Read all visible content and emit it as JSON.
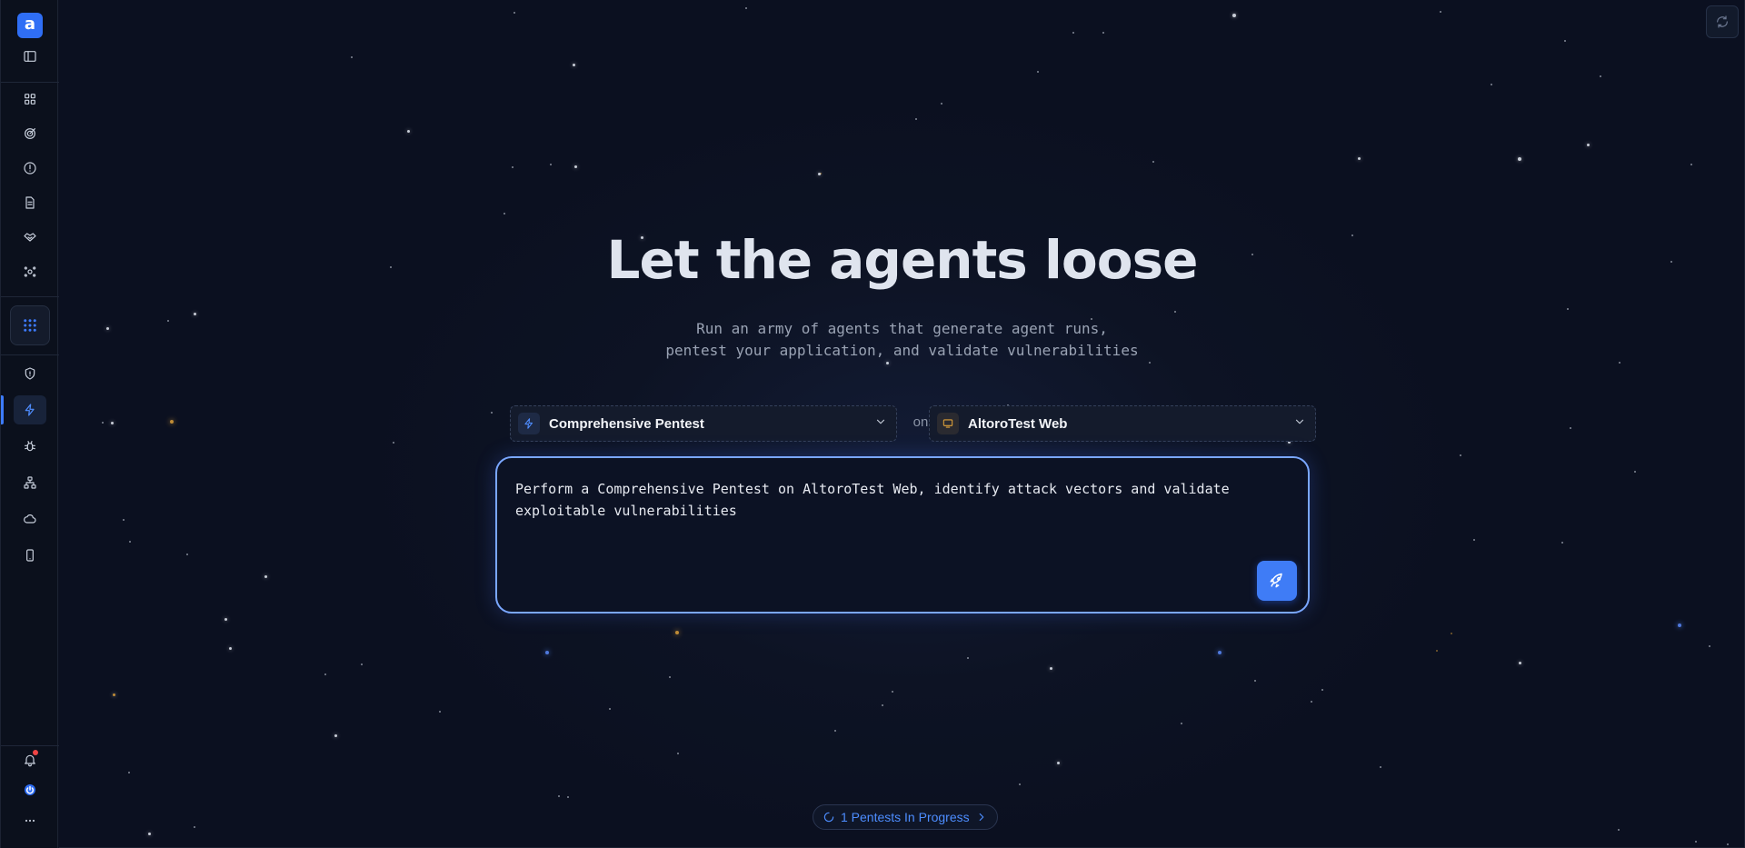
{
  "sidebar": {
    "logo_letter": "a",
    "items": [
      {
        "name": "sidebar-toggle",
        "icon": "sidebar-panel-icon"
      },
      {
        "name": "dashboard",
        "icon": "grid-icon"
      },
      {
        "name": "targets",
        "icon": "target-icon"
      },
      {
        "name": "issues",
        "icon": "alert-circle-icon"
      },
      {
        "name": "reports",
        "icon": "document-icon"
      },
      {
        "name": "integrations",
        "icon": "handshake-icon"
      },
      {
        "name": "agents",
        "icon": "hub-icon"
      },
      {
        "name": "apps",
        "icon": "grid-dots-icon"
      },
      {
        "name": "security",
        "icon": "shield-icon"
      },
      {
        "name": "pentests",
        "icon": "lightning-icon",
        "active": true
      },
      {
        "name": "bugs",
        "icon": "bug-icon"
      },
      {
        "name": "network",
        "icon": "network-icon"
      },
      {
        "name": "cloud",
        "icon": "cloud-icon"
      },
      {
        "name": "mobile",
        "icon": "phone-icon"
      }
    ],
    "bottom": [
      {
        "name": "notifications",
        "icon": "bell-icon",
        "has_badge": true
      },
      {
        "name": "power",
        "icon": "power-icon"
      },
      {
        "name": "more",
        "icon": "ellipsis-icon"
      }
    ],
    "accent": "#2f6ef5"
  },
  "hero": {
    "title": "Let the agents loose",
    "subtitle_line1": "Run an army of agents that generate agent runs,",
    "subtitle_line2": "pentest your application, and validate vulnerabilities"
  },
  "selectors": {
    "scan_type": "Comprehensive Pentest",
    "connector": "on",
    "target": "AltoroTest Web"
  },
  "prompt": {
    "line1": "Perform a Comprehensive Pentest on AltoroTest Web, identify attack vectors and validate",
    "line2": "exploitable vulnerabilities"
  },
  "status": {
    "in_progress_label": "1 Pentests In Progress"
  }
}
